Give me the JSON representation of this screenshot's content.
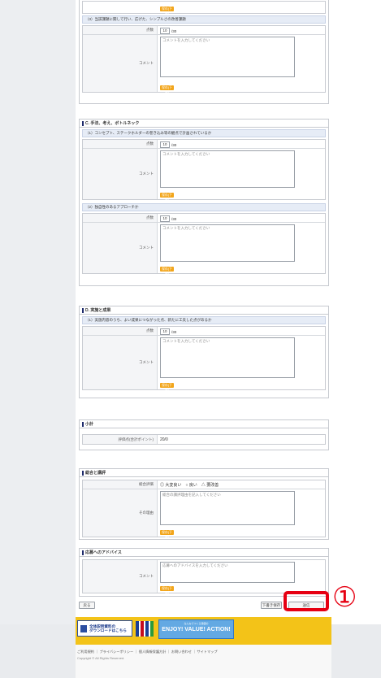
{
  "app": {
    "score_label": "点数",
    "comment_label": "コメント",
    "score_value": "10",
    "score_max": "/30",
    "comment_placeholder": "コメントを入力してください",
    "save_label": "保存(下書)"
  },
  "sections": {
    "top_q3": {
      "q": "（3）当該課題に関して行い、広げた、シンプルさの改善課題"
    },
    "c": {
      "title": "C. 手法、考え、ボトルネック",
      "q1": "（1）コンセプト、ステークホルダーの巻き込み等の観点で計画されているか",
      "q2": "（2）独自性のあるアプローチか"
    },
    "d": {
      "title": "D. 実施と成果",
      "q1": "（1）実施内容のうち、よい成果につながった点、新たに工夫した点があるか"
    },
    "total": {
      "title": "小計",
      "label": "評価点(合計ポイント)",
      "value": "20/0"
    },
    "overall": {
      "title": "総合と講評",
      "label": "総合評価",
      "options": "◎ 大変良い　○ 良い　△ 要改善",
      "reason_label": "その理由",
      "reason_placeholder": "総合の講評理由を記入してください"
    },
    "advice": {
      "title": "応募へのアドバイス",
      "label": "コメント",
      "placeholder": "応募へのアドバイスを入力してください"
    }
  },
  "footer": {
    "back": "戻る",
    "save_draft": "下書き保存",
    "submit": "送信"
  },
  "annotation": {
    "number": "①"
  },
  "banner": {
    "download_text": "全体説明資料の\nダウンロードはこちら",
    "enjoy": "ENJOY! VALUE! ACTION!",
    "enjoy_sub": "みんなでつくる価値の"
  },
  "bottom": {
    "links": "ご利用規約 ｜ プライバシーポリシー ｜ 個人情報保護方針 ｜ お問い合わせ ｜ サイトマップ",
    "copyright": "Copyright © All Rights Reserved."
  }
}
